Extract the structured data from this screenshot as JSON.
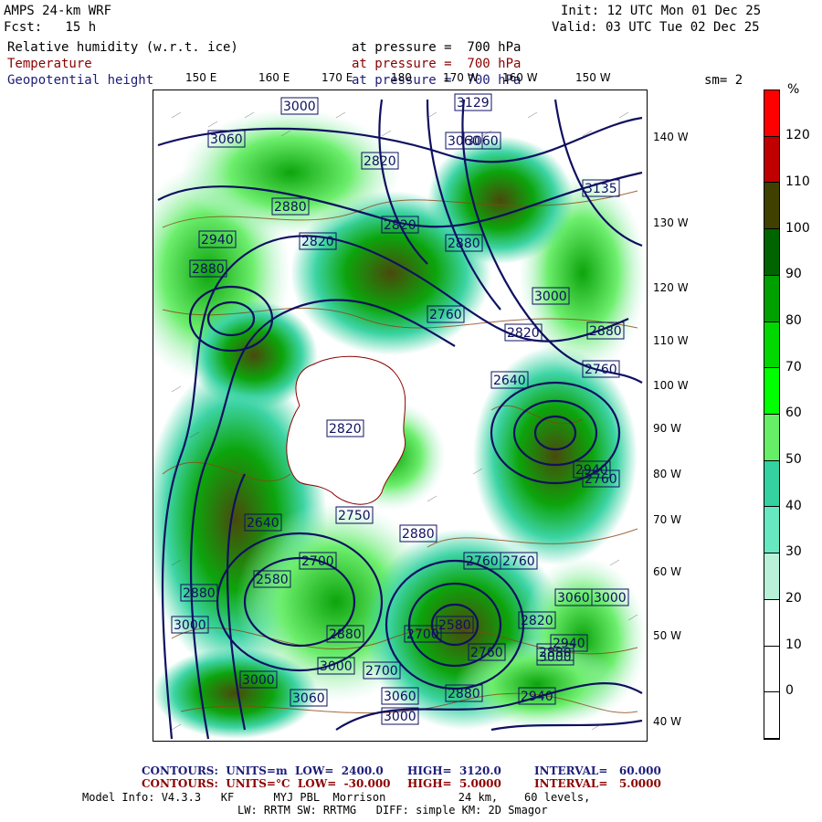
{
  "header": {
    "model": "AMPS 24-km WRF",
    "init": "Init: 12 UTC Mon 01 Dec 25",
    "fcst": "Fcst:   15 h",
    "valid": "Valid: 03 UTC Tue 02 Dec 25",
    "sm": "sm= 2"
  },
  "fields": [
    {
      "name": "Relative humidity (w.r.t. ice)",
      "level": "at pressure =  700 hPa",
      "color": "#000000"
    },
    {
      "name": "Temperature",
      "level": "at pressure =  700 hPa",
      "color": "#8b0000"
    },
    {
      "name": "Geopotential height",
      "level": "at pressure =  700 hPa",
      "color": "#1c1c7a"
    }
  ],
  "longitude_labels": [
    "150 E",
    "160 E",
    "170 E",
    "180",
    "170 W",
    "160 W",
    "150 W"
  ],
  "latitude_labels": [
    "140 W",
    "130 W",
    "120 W",
    "110 W",
    "100 W",
    "90 W",
    "80 W",
    "70 W",
    "60 W",
    "50 W",
    "40 W"
  ],
  "colorbar": {
    "unit": "%",
    "labels": [
      "120",
      "110",
      "100",
      "90",
      "80",
      "70",
      "60",
      "50",
      "40",
      "30",
      "20",
      "10",
      "0"
    ],
    "colors": [
      "#ff0000",
      "#c00000",
      "#404000",
      "#006400",
      "#00a000",
      "#00d800",
      "#00ff00",
      "#66ee66",
      "#33d2a0",
      "#66e8c0",
      "#b8f0d8",
      "#ffffff",
      "#ffffff",
      "#ffffff"
    ]
  },
  "height_labels": [
    "3000",
    "3129",
    "3060",
    "3060",
    "2820",
    "3135",
    "3060",
    "2880",
    "2820",
    "2940",
    "2880",
    "2820",
    "2880",
    "3000",
    "2760",
    "2820",
    "2880",
    "2820",
    "2640",
    "2760",
    "2760",
    "2640",
    "2750",
    "2880",
    "2700",
    "2760",
    "2580",
    "2820",
    "2880",
    "3000",
    "2880",
    "3000",
    "2700",
    "3000",
    "3060",
    "3060",
    "2880",
    "2940",
    "2940",
    "2880",
    "3000",
    "2940",
    "3060",
    "2760",
    "2760",
    "2700",
    "2580",
    "3000",
    "3000"
  ],
  "footer": {
    "line1_left": "CONTOURS:  UNITS=m  LOW=  2400.0",
    "line1_mid": "HIGH=  3120.0",
    "line1_right": "INTERVAL=   60.000",
    "line2_left": "CONTOURS:  UNITS=°C  LOW=  -30.000",
    "line2_mid": "HIGH=  5.0000",
    "line2_right": "INTERVAL=   5.0000",
    "line3": "Model Info: V4.3.3   KF      MYJ PBL  Morrison           24 km,    60 levels,",
    "line4": "LW: RRTM SW: RRTMG   DIFF: simple KM: 2D Smagor"
  }
}
